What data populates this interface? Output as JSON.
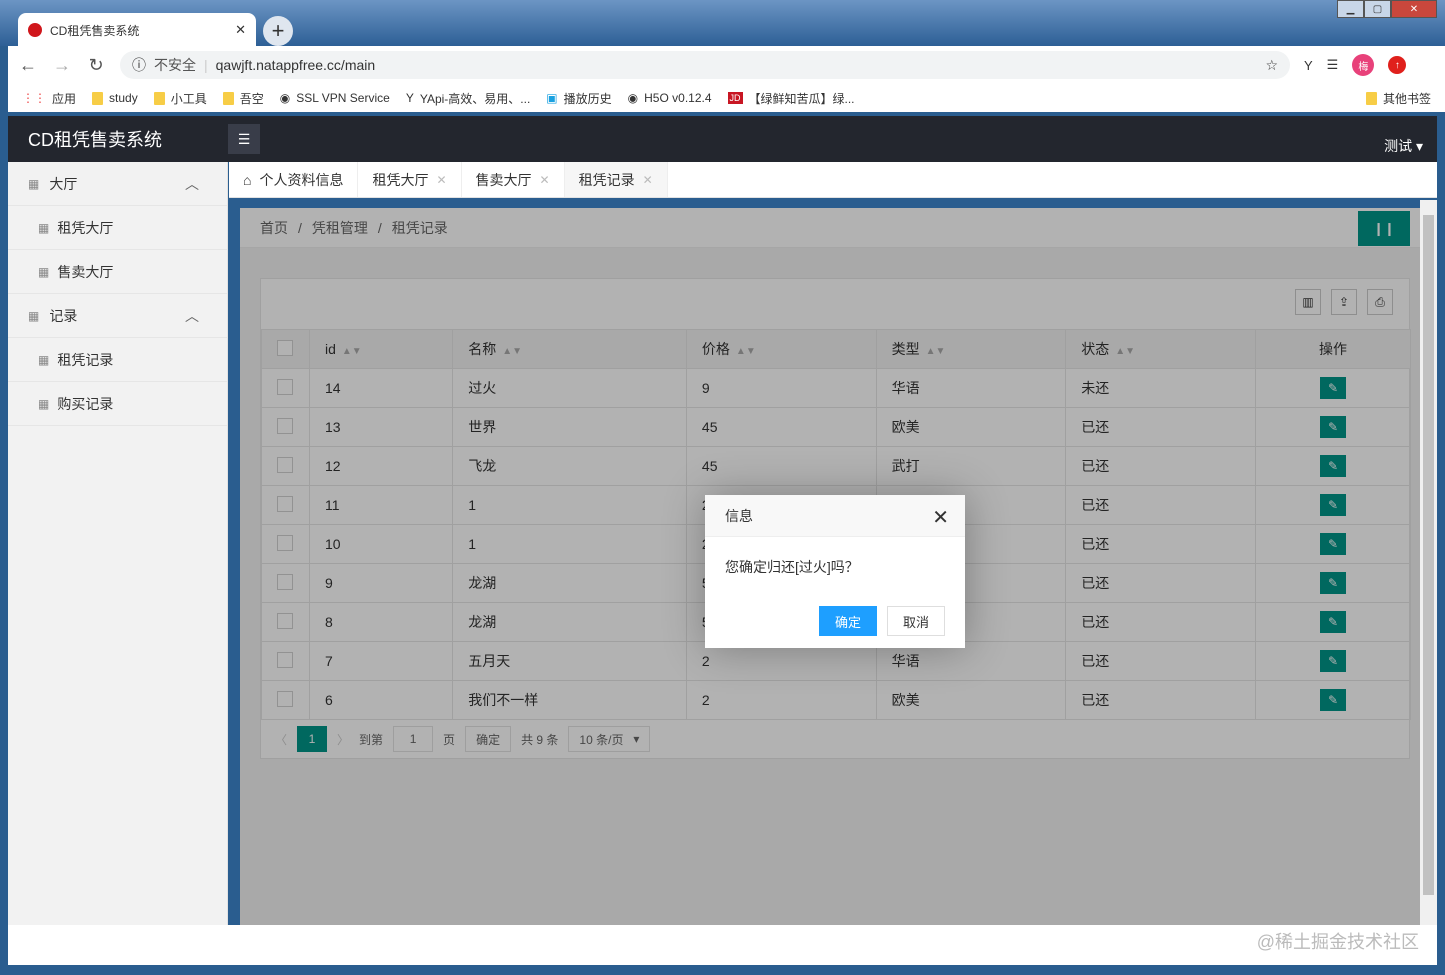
{
  "browser": {
    "tab_title": "CD租凭售卖系统",
    "security": "不安全",
    "url": "qawjft.natappfree.cc/main",
    "profile": "梅",
    "bookmarks": [
      "应用",
      "study",
      "小工具",
      "吾空",
      "SSL VPN Service",
      "YApi-高效、易用、...",
      "播放历史",
      "H5O v0.12.4",
      "【绿鲜知苦瓜】绿..."
    ],
    "other_bookmarks": "其他书签"
  },
  "app": {
    "title": "CD租凭售卖系统",
    "user": "测试 ▾"
  },
  "sidebar": {
    "groups": [
      {
        "label": "大厅",
        "items": [
          "租凭大厅",
          "售卖大厅"
        ]
      },
      {
        "label": "记录",
        "items": [
          "租凭记录",
          "购买记录"
        ]
      }
    ]
  },
  "tabs": [
    "个人资料信息",
    "租凭大厅",
    "售卖大厅",
    "租凭记录"
  ],
  "breadcrumb": [
    "首页",
    "凭租管理",
    "租凭记录"
  ],
  "table": {
    "headers": [
      "id",
      "名称",
      "价格",
      "类型",
      "状态",
      "操作"
    ],
    "rows": [
      [
        "14",
        "过火",
        "9",
        "华语",
        "未还"
      ],
      [
        "13",
        "世界",
        "45",
        "欧美",
        "已还"
      ],
      [
        "12",
        "飞龙",
        "45",
        "武打",
        "已还"
      ],
      [
        "11",
        "1",
        "2",
        "",
        "已还"
      ],
      [
        "10",
        "1",
        "2",
        "",
        "已还"
      ],
      [
        "9",
        "龙湖",
        "5",
        "",
        "已还"
      ],
      [
        "8",
        "龙湖",
        "5",
        "",
        "已还"
      ],
      [
        "7",
        "五月天",
        "2",
        "华语",
        "已还"
      ],
      [
        "6",
        "我们不一样",
        "2",
        "欧美",
        "已还"
      ]
    ]
  },
  "pager": {
    "current": "1",
    "goto_label": "到第",
    "goto_value": "1",
    "page_label": "页",
    "confirm": "确定",
    "total": "共 9 条",
    "per_page": "10 条/页"
  },
  "modal": {
    "title": "信息",
    "message": "您确定归还[过火]吗？",
    "ok": "确定",
    "cancel": "取消"
  },
  "watermark": "@稀土掘金技术社区"
}
